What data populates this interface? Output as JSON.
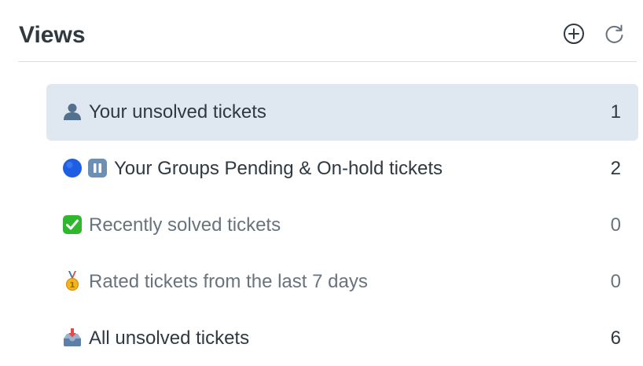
{
  "header": {
    "title": "Views",
    "add_icon": "add-circle-icon",
    "refresh_icon": "refresh-icon"
  },
  "views": [
    {
      "label": "Your unsolved tickets",
      "count": "1",
      "icons": [
        "bust-in-silhouette-icon"
      ],
      "selected": true
    },
    {
      "label": "Your Groups Pending & On-hold tickets",
      "count": "2",
      "icons": [
        "blue-circle-icon",
        "pause-button-icon"
      ],
      "selected": false
    },
    {
      "label": "Recently solved tickets",
      "count": "0",
      "icons": [
        "check-mark-button-icon"
      ],
      "selected": false
    },
    {
      "label": "Rated tickets from the last 7 days",
      "count": "0",
      "icons": [
        "first-place-medal-icon"
      ],
      "selected": false
    },
    {
      "label": "All unsolved tickets",
      "count": "6",
      "icons": [
        "inbox-tray-icon"
      ],
      "selected": false
    }
  ],
  "colors": {
    "selected_bg": "#dfe7f1",
    "text_dark": "#2f3941",
    "text_muted": "#68737d",
    "divider": "#d8dcde"
  }
}
